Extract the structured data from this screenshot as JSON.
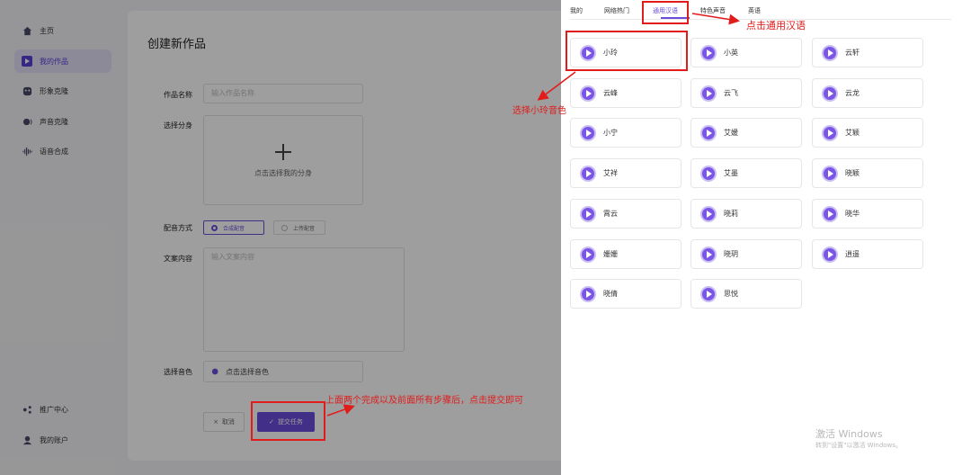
{
  "sidebar": {
    "items": [
      {
        "label": "主页",
        "icon": "home-icon"
      },
      {
        "label": "我的作品",
        "icon": "video-icon",
        "active": true
      },
      {
        "label": "形象克隆",
        "icon": "face-icon"
      },
      {
        "label": "声音克隆",
        "icon": "voice-icon"
      },
      {
        "label": "语音合成",
        "icon": "waveform-icon"
      }
    ],
    "bottom": [
      {
        "label": "推广中心",
        "icon": "share-icon"
      },
      {
        "label": "我的账户",
        "icon": "user-icon"
      }
    ]
  },
  "form": {
    "title": "创建新作品",
    "name_label": "作品名称",
    "name_placeholder": "输入作品名称",
    "avatar_label": "选择分身",
    "avatar_hint": "点击选择我的分身",
    "dub_label": "配音方式",
    "dub_option_synth": "合成配音",
    "dub_option_upload": "上传配音",
    "text_label": "文案内容",
    "text_placeholder": "输入文案内容",
    "voice_label": "选择音色",
    "voice_hint": "点击选择音色",
    "cancel_label": "取消",
    "submit_label": "提交任务"
  },
  "panel": {
    "tabs": [
      "我的",
      "网络热门",
      "通用汉语",
      "特色声音",
      "英语"
    ],
    "active_tab": "通用汉语",
    "voices": [
      "小玲",
      "小英",
      "云轩",
      "云峰",
      "云飞",
      "云龙",
      "小宁",
      "艾媛",
      "艾颖",
      "艾祥",
      "艾墨",
      "晓颖",
      "霄云",
      "晓莉",
      "晓华",
      "姗姗",
      "晓玥",
      "逍遥",
      "晓倩",
      "思悦"
    ],
    "watermark_title": "激活 Windows",
    "watermark_sub": "转到\"设置\"以激活 Windows。"
  },
  "annotations": {
    "click_tab": "点击通用汉语",
    "select_voice": "选择小玲音色",
    "submit_hint": "上面两个完成以及前面所有步骤后，点击提交即可"
  },
  "colors": {
    "accent": "#6b4ddb",
    "annotation": "#e21b1b"
  }
}
